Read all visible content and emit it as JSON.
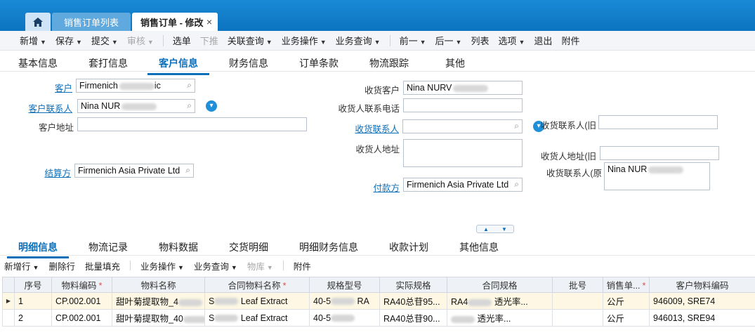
{
  "tabs": {
    "home_icon": "home-icon",
    "list_tab": "销售订单列表",
    "active_tab": "销售订单 - 修改",
    "close_glyph": "×"
  },
  "toolbar": [
    {
      "label": "新增",
      "dropdown": true,
      "disabled": false
    },
    {
      "label": "保存",
      "dropdown": true,
      "disabled": false
    },
    {
      "label": "提交",
      "dropdown": true,
      "disabled": false
    },
    {
      "label": "审核",
      "dropdown": true,
      "disabled": true
    },
    {
      "sep": true
    },
    {
      "label": "选单",
      "dropdown": false,
      "disabled": false
    },
    {
      "label": "下推",
      "dropdown": false,
      "disabled": true
    },
    {
      "label": "关联查询",
      "dropdown": true,
      "disabled": false
    },
    {
      "label": "业务操作",
      "dropdown": true,
      "disabled": false
    },
    {
      "label": "业务查询",
      "dropdown": true,
      "disabled": false
    },
    {
      "sep": true
    },
    {
      "label": "前一",
      "dropdown": true,
      "disabled": false
    },
    {
      "label": "后一",
      "dropdown": true,
      "disabled": false
    },
    {
      "label": "列表",
      "dropdown": false,
      "disabled": false
    },
    {
      "label": "选项",
      "dropdown": true,
      "disabled": false
    },
    {
      "label": "退出",
      "dropdown": false,
      "disabled": false
    },
    {
      "label": "附件",
      "dropdown": false,
      "disabled": false
    }
  ],
  "main_tabs": {
    "basic": "基本信息",
    "print": "套打信息",
    "customer": "客户信息",
    "finance": "财务信息",
    "terms": "订单条款",
    "logistics": "物流跟踪",
    "other": "其他"
  },
  "form": {
    "customer_label": "客户",
    "customer_value": "Firmenich",
    "customer_value_tail": "ic",
    "customer_contact_label": "客户联系人",
    "customer_contact_value": "Nina NUR",
    "customer_address_label": "客户地址",
    "customer_address_value": "",
    "settlement_label": "结算方",
    "settlement_value": "Firmenich Asia Private Ltd",
    "recv_customer_label": "收货客户",
    "recv_customer_value": "Nina NURV",
    "recv_phone_label": "收货人联系电话",
    "recv_phone_value": "",
    "recv_contact_label": "收货联系人",
    "recv_contact_value": "",
    "recv_address_label": "收货人地址",
    "recv_address_value": "",
    "payer_label": "付款方",
    "payer_value": "Firmenich Asia Private Ltd",
    "recv_contact_old_label": "收货联系人(旧",
    "recv_contact_old_value": "",
    "recv_address_old_label": "收货人地址(旧",
    "recv_address_old_value": "",
    "recv_contact_orig_label": "收货联系人(原",
    "recv_contact_orig_value": "Nina NUR"
  },
  "detail_tabs": {
    "detail": "明细信息",
    "logistics": "物流记录",
    "material": "物料数据",
    "delivery": "交货明细",
    "finance": "明细财务信息",
    "plan": "收款计划",
    "other": "其他信息"
  },
  "detail_toolbar": {
    "add_row": "新增行",
    "delete_row": "删除行",
    "bulk_fill": "批量填充",
    "biz_ops": "业务操作",
    "biz_query": "业务查询",
    "warehouse": "物库",
    "attachment": "附件"
  },
  "grid": {
    "columns": [
      {
        "label": "序号",
        "required": false
      },
      {
        "label": "物料编码",
        "required": true
      },
      {
        "label": "物料名称",
        "required": false
      },
      {
        "label": "合同物料名称",
        "required": true
      },
      {
        "label": "规格型号",
        "required": false
      },
      {
        "label": "实际规格",
        "required": false
      },
      {
        "label": "合同规格",
        "required": false
      },
      {
        "label": "批号",
        "required": false
      },
      {
        "label": "销售单...",
        "required": true
      },
      {
        "label": "客户物料编码",
        "required": false
      }
    ],
    "rows": [
      {
        "seq": "1",
        "code": "CP.002.001",
        "name": "甜叶菊提取物_4",
        "contract_name": "S",
        "contract_name_tail": "Leaf Extract",
        "spec": "40-5",
        "spec_tail": "RA",
        "actual_spec": "RA40总苷95...",
        "contract_spec": "RA4",
        "contract_spec_tail": "透光率...",
        "batch": "",
        "unit": "公斤",
        "customer_code": "946009,   SRE74"
      },
      {
        "seq": "2",
        "code": "CP.002.001",
        "name": "甜叶菊提取物_40",
        "contract_name": "S",
        "contract_name_tail": "Leaf Extract",
        "spec": "40-5",
        "spec_tail": "",
        "actual_spec": "RA40总苷90...",
        "contract_spec": "",
        "contract_spec_tail": "透光率...",
        "batch": "",
        "unit": "公斤",
        "customer_code": "946013,   SRE94"
      }
    ]
  },
  "colors": {
    "accent": "#0b6fba",
    "topbar": "#1a8ad6",
    "selected_row": "#fdf7e3"
  }
}
